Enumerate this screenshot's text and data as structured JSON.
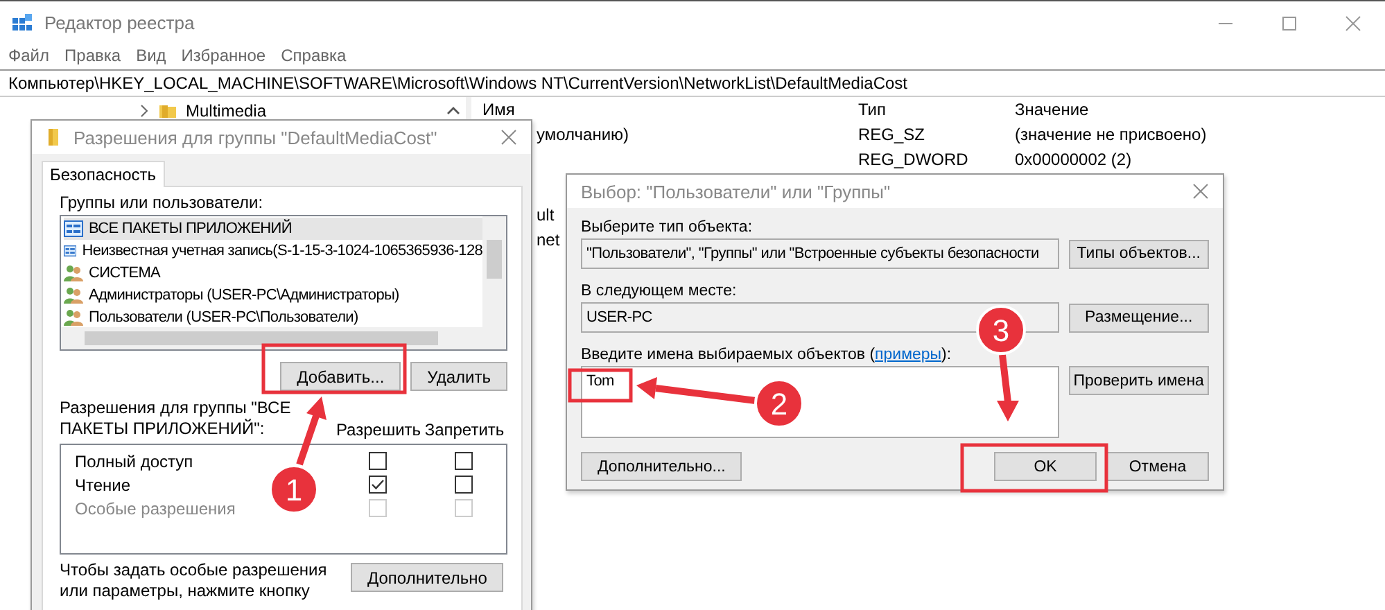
{
  "window": {
    "title": "Редактор реестра"
  },
  "menu": [
    "Файл",
    "Правка",
    "Вид",
    "Избранное",
    "Справка"
  ],
  "address": "Компьютер\\HKEY_LOCAL_MACHINE\\SOFTWARE\\Microsoft\\Windows NT\\CurrentVersion\\NetworkList\\DefaultMediaCost",
  "tree": {
    "items": [
      {
        "label": "Multimedia",
        "expanded": false
      }
    ]
  },
  "values_pane": {
    "columns": [
      "Имя",
      "Тип",
      "Значение"
    ],
    "rows": [
      {
        "name": "умолчанию)",
        "type": "REG_SZ",
        "value": "(значение не присвоено)"
      },
      {
        "type": "REG_DWORD",
        "value": "0x00000002 (2)"
      },
      {
        "name": "ult"
      },
      {
        "name": "net"
      }
    ]
  },
  "perm_dialog": {
    "title": "Разрешения для группы \"DefaultMediaCost\"",
    "tabs": [
      {
        "label": "Безопасность",
        "selected": true
      }
    ],
    "groups_label": "Группы или пользователи:",
    "principals": [
      {
        "name": "ВСЕ ПАКЕТЫ ПРИЛОЖЕНИЙ",
        "kind": "package",
        "selected": true
      },
      {
        "name": "Неизвестная учетная запись(S-1-15-3-1024-1065365936-128",
        "kind": "package",
        "selected": false
      },
      {
        "name": "СИСТЕМА",
        "kind": "group",
        "selected": false
      },
      {
        "name": "Администраторы (USER-PC\\Администраторы)",
        "kind": "group",
        "selected": false
      },
      {
        "name": "Пользователи (USER-PC\\Пользователи)",
        "kind": "group",
        "selected": false
      }
    ],
    "add_button": "Добавить...",
    "remove_button": "Удалить",
    "perm_label": "Разрешения для группы \"ВСЕ ПАКЕТЫ ПРИЛОЖЕНИЙ\":",
    "columns": [
      "Разрешить",
      "Запретить"
    ],
    "permissions": [
      {
        "name": "Полный доступ",
        "allow": false,
        "deny": false,
        "disabled": false
      },
      {
        "name": "Чтение",
        "allow": true,
        "deny": false,
        "disabled": false
      },
      {
        "name": "Особые разрешения",
        "allow": false,
        "deny": false,
        "disabled": true
      }
    ],
    "note": "Чтобы задать особые разрешения или параметры, нажмите кнопку",
    "advanced_button": "Дополнительно"
  },
  "select_dialog": {
    "title": "Выбор: \"Пользователи\" или \"Группы\"",
    "object_type_label": "Выберите тип объекта:",
    "object_type": "\"Пользователи\", \"Группы\" или \"Встроенные субъекты безопасности",
    "object_types_button": "Типы объектов...",
    "location_label": "В следующем месте:",
    "location": "USER-PC",
    "location_button": "Размещение...",
    "names_label": {
      "text_before": "Введите имена выбираемых объектов (",
      "link": "примеры",
      "text_after": "):"
    },
    "names_value": "Tom",
    "check_names_button": "Проверить имена",
    "advanced_button": "Дополнительно...",
    "ok_button": "OK",
    "cancel_button": "Отмена"
  },
  "annotations": [
    {
      "number": "1"
    },
    {
      "number": "2"
    },
    {
      "number": "3"
    }
  ]
}
